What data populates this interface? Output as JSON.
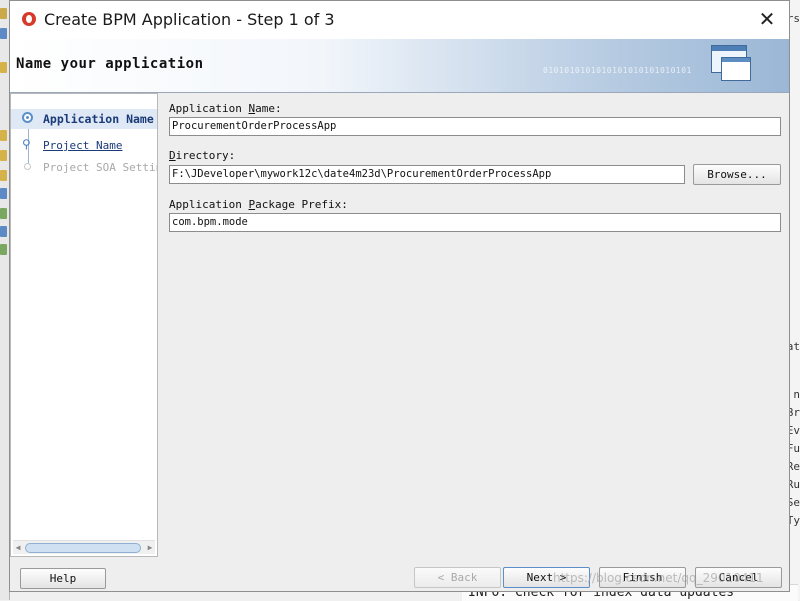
{
  "dialog": {
    "title": "Create BPM Application - Step 1 of 3",
    "close_glyph": "✕"
  },
  "banner": {
    "heading": "Name your application",
    "binary_text": "0101010101010101010101010101"
  },
  "steps": [
    {
      "label": "Application Name",
      "state": "current"
    },
    {
      "label": "Project Name",
      "state": "link"
    },
    {
      "label": "Project SOA Settings",
      "state": "disabled"
    }
  ],
  "form": {
    "app_name": {
      "label": "Application Name:",
      "mnemonic": "N",
      "value": "ProcurementOrderProcessApp"
    },
    "directory": {
      "label": "Directory:",
      "mnemonic": "D",
      "value": "F:\\JDeveloper\\mywork12c\\date4m23d\\ProcurementOrderProcessApp",
      "browse_label": "Browse..."
    },
    "package_prefix": {
      "label": "Application Package Prefix:",
      "mnemonic": "P",
      "value": "com.bpm.mode"
    }
  },
  "buttons": {
    "help": "Help",
    "back": "< Back",
    "next": "Next >",
    "finish": "Finish",
    "cancel": "Cancel"
  },
  "background": {
    "bottom_log": "INFO: Check for index data updates",
    "right_fragments": [
      "rs",
      "at",
      "n",
      "Br",
      "Ev",
      "Fu",
      "Re",
      "Ru",
      "Se",
      "Ty"
    ],
    "watermark": "https://blog.csdn.net/qq_29010411"
  },
  "colors": {
    "accent": "#5b8fc9",
    "step_link": "#1b3a78",
    "logo": "#d63a2a"
  }
}
